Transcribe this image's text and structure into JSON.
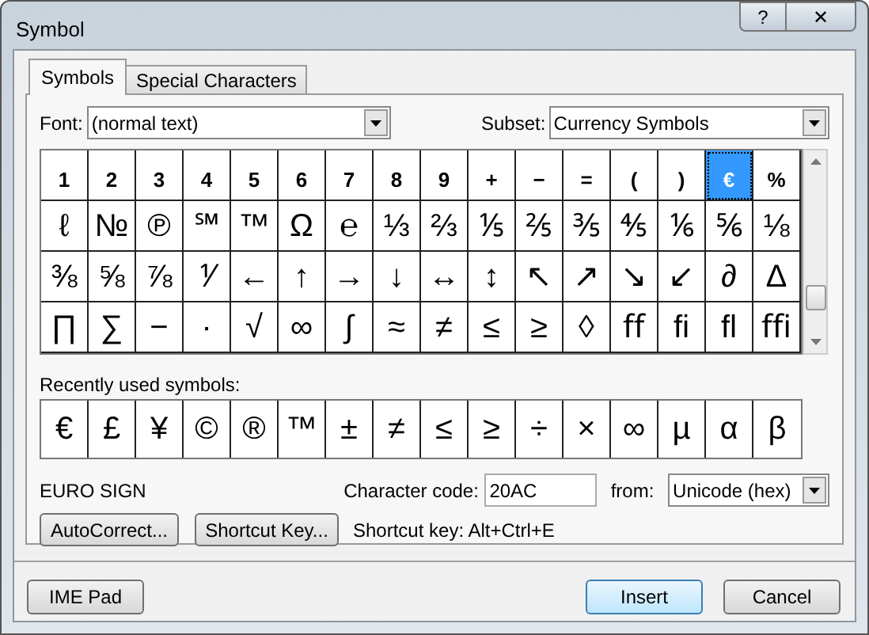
{
  "window": {
    "title": "Symbol",
    "help": "?",
    "close": "✕"
  },
  "tabs": [
    {
      "label": "Symbols",
      "selected": true
    },
    {
      "label": "Special Characters",
      "selected": false
    }
  ],
  "font": {
    "label": "Font:",
    "value": "(normal text)"
  },
  "subset": {
    "label": "Subset:",
    "value": "Currency Symbols"
  },
  "symbol_grid": [
    [
      {
        "char": "1",
        "selected": false
      },
      {
        "char": "2",
        "selected": false
      },
      {
        "char": "3",
        "selected": false
      },
      {
        "char": "4",
        "selected": false
      },
      {
        "char": "5",
        "selected": false
      },
      {
        "char": "6",
        "selected": false
      },
      {
        "char": "7",
        "selected": false
      },
      {
        "char": "8",
        "selected": false
      },
      {
        "char": "9",
        "selected": false
      },
      {
        "char": "+",
        "selected": false
      },
      {
        "char": "−",
        "selected": false
      },
      {
        "char": "=",
        "selected": false
      },
      {
        "char": "(",
        "selected": false
      },
      {
        "char": ")",
        "selected": false
      },
      {
        "char": "€",
        "selected": true
      },
      {
        "char": "%",
        "selected": false
      }
    ],
    [
      {
        "char": "ℓ",
        "selected": false
      },
      {
        "char": "№",
        "selected": false
      },
      {
        "char": "℗",
        "selected": false
      },
      {
        "char": "℠",
        "selected": false
      },
      {
        "char": "™",
        "selected": false
      },
      {
        "char": "Ω",
        "selected": false
      },
      {
        "char": "℮",
        "selected": false
      },
      {
        "char": "⅓",
        "selected": false
      },
      {
        "char": "⅔",
        "selected": false
      },
      {
        "char": "⅕",
        "selected": false
      },
      {
        "char": "⅖",
        "selected": false
      },
      {
        "char": "⅗",
        "selected": false
      },
      {
        "char": "⅘",
        "selected": false
      },
      {
        "char": "⅙",
        "selected": false
      },
      {
        "char": "⅚",
        "selected": false
      },
      {
        "char": "⅛",
        "selected": false
      }
    ],
    [
      {
        "char": "⅜",
        "selected": false
      },
      {
        "char": "⅝",
        "selected": false
      },
      {
        "char": "⅞",
        "selected": false
      },
      {
        "char": "⅟",
        "selected": false
      },
      {
        "char": "←",
        "selected": false
      },
      {
        "char": "↑",
        "selected": false
      },
      {
        "char": "→",
        "selected": false
      },
      {
        "char": "↓",
        "selected": false
      },
      {
        "char": "↔",
        "selected": false
      },
      {
        "char": "↕",
        "selected": false
      },
      {
        "char": "↖",
        "selected": false
      },
      {
        "char": "↗",
        "selected": false
      },
      {
        "char": "↘",
        "selected": false
      },
      {
        "char": "↙",
        "selected": false
      },
      {
        "char": "∂",
        "selected": false
      },
      {
        "char": "∆",
        "selected": false
      }
    ],
    [
      {
        "char": "∏",
        "selected": false
      },
      {
        "char": "∑",
        "selected": false
      },
      {
        "char": "−",
        "selected": false
      },
      {
        "char": "∙",
        "selected": false
      },
      {
        "char": "√",
        "selected": false
      },
      {
        "char": "∞",
        "selected": false
      },
      {
        "char": "∫",
        "selected": false
      },
      {
        "char": "≈",
        "selected": false
      },
      {
        "char": "≠",
        "selected": false
      },
      {
        "char": "≤",
        "selected": false
      },
      {
        "char": "≥",
        "selected": false
      },
      {
        "char": "◊",
        "selected": false
      },
      {
        "char": "ﬀ",
        "selected": false
      },
      {
        "char": "ﬁ",
        "selected": false
      },
      {
        "char": "ﬂ",
        "selected": false
      },
      {
        "char": "ﬃ",
        "selected": false
      }
    ]
  ],
  "recent": {
    "label": "Recently used symbols:",
    "symbols": [
      "€",
      "£",
      "¥",
      "©",
      "®",
      "™",
      "±",
      "≠",
      "≤",
      "≥",
      "÷",
      "×",
      "∞",
      "µ",
      "α",
      "β"
    ]
  },
  "char_name": "EURO SIGN",
  "character_code": {
    "label": "Character code:",
    "value": "20AC"
  },
  "from": {
    "label": "from:",
    "value": "Unicode (hex)"
  },
  "autocorrect_button": "AutoCorrect...",
  "shortcut_key_button": "Shortcut Key...",
  "shortcut_text": "Shortcut key: Alt+Ctrl+E",
  "footer_buttons": [
    {
      "label": "IME Pad",
      "kind": "normal"
    },
    {
      "label": "Insert",
      "kind": "default"
    },
    {
      "label": "Cancel",
      "kind": "normal"
    }
  ]
}
